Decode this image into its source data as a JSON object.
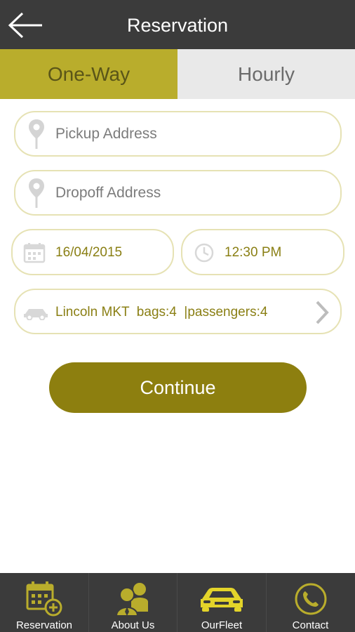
{
  "header": {
    "title": "Reservation"
  },
  "tabs": [
    {
      "label": "One-Way",
      "active": true
    },
    {
      "label": "Hourly",
      "active": false
    }
  ],
  "form": {
    "pickup_placeholder": "Pickup Address",
    "dropoff_placeholder": "Dropoff Address",
    "date_value": "16/04/2015",
    "time_value": "12:30 PM",
    "vehicle_value": "Lincoln MKT  bags:4  |passengers:4"
  },
  "continue_label": "Continue",
  "bottom_nav": [
    {
      "label": "Reservation",
      "icon": "calendar-add-icon"
    },
    {
      "label": "About Us",
      "icon": "people-icon"
    },
    {
      "label": "OurFleet",
      "icon": "car-icon"
    },
    {
      "label": "Contact",
      "icon": "phone-icon"
    }
  ],
  "colors": {
    "accent": "#b9ad2c",
    "button": "#8d7f0f",
    "bar": "#3b3b3b",
    "field_border": "#e6e2b4"
  }
}
